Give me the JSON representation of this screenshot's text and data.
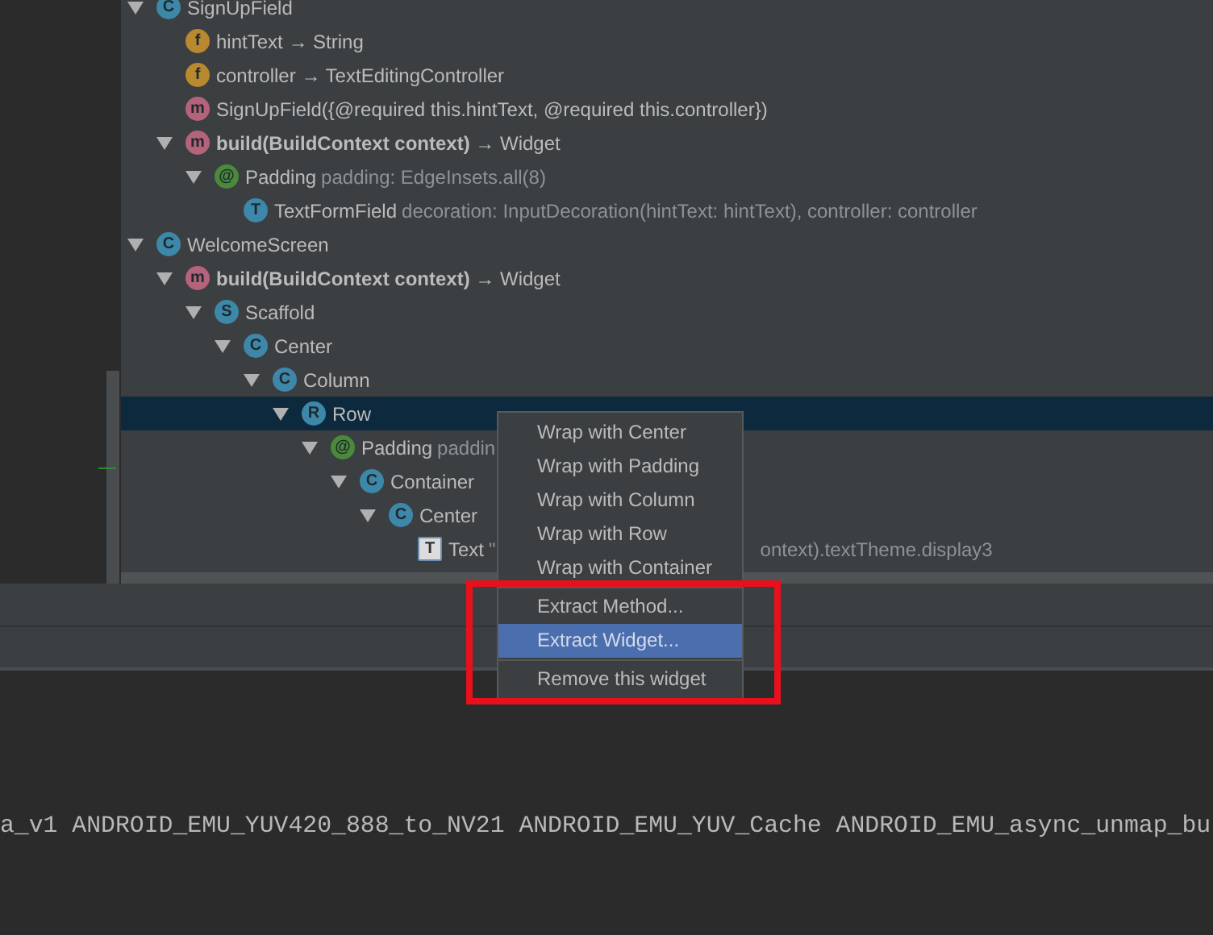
{
  "structure_tree": [
    {
      "letter": "C",
      "kind": "class",
      "name": "SignUpField",
      "expanded": true,
      "selected": false,
      "children": [
        {
          "letter": "f",
          "kind": "field",
          "name": "hintText → String",
          "selected": false
        },
        {
          "letter": "f",
          "kind": "field",
          "name": "controller → TextEditingController",
          "selected": false
        },
        {
          "letter": "m",
          "kind": "method",
          "name": "SignUpField({@required this.hintText, @required this.controller})",
          "selected": false
        },
        {
          "letter": "m",
          "kind": "method",
          "name": "**build(BuildContext context)** → Widget",
          "expanded": true,
          "selected": false,
          "children": [
            {
              "letter": "@",
              "kind": "annotation",
              "name": "Padding",
              "detail": "padding: EdgeInsets.all(8)",
              "expanded": true,
              "selected": false,
              "children": [
                {
                  "letter": "T",
                  "kind": "class",
                  "name": "TextFormField",
                  "detail": "decoration: InputDecoration(hintText: hintText), controller: controller",
                  "selected": false
                }
              ]
            }
          ]
        }
      ]
    },
    {
      "letter": "C",
      "kind": "class",
      "name": "WelcomeScreen",
      "expanded": true,
      "selected": false,
      "children": [
        {
          "letter": "m",
          "kind": "method",
          "name": "**build(BuildContext context)** → Widget",
          "expanded": true,
          "selected": false,
          "children": [
            {
              "letter": "S",
              "kind": "class",
              "name": "Scaffold",
              "expanded": true,
              "selected": false,
              "children": [
                {
                  "letter": "C",
                  "kind": "class",
                  "name": "Center",
                  "expanded": true,
                  "selected": false,
                  "children": [
                    {
                      "letter": "C",
                      "kind": "class",
                      "name": "Column",
                      "expanded": true,
                      "selected": false,
                      "children": [
                        {
                          "letter": "R",
                          "kind": "class",
                          "name": "Row",
                          "expanded": true,
                          "selected": true,
                          "children": [
                            {
                              "letter": "@",
                              "kind": "annotation",
                              "name": "Padding",
                              "detail": "paddin",
                              "expanded": true,
                              "selected": false,
                              "children": [
                                {
                                  "letter": "C",
                                  "kind": "class",
                                  "name": "Container",
                                  "expanded": true,
                                  "selected": false,
                                  "children": [
                                    {
                                      "letter": "C",
                                      "kind": "class",
                                      "name": "Center",
                                      "expanded": true,
                                      "selected": false,
                                      "children": [
                                        {
                                          "letter": "T",
                                          "kind": "text",
                                          "name": "Text",
                                          "detail": "\"",
                                          "detail_after_menu": "ontext).textTheme.display3",
                                          "selected": false
                                        }
                                      ]
                                    }
                                  ]
                                }
                              ]
                            }
                          ]
                        }
                      ]
                    }
                  ]
                }
              ]
            }
          ]
        }
      ]
    }
  ],
  "context_menu": [
    {
      "label": "Wrap with Center",
      "selected": false
    },
    {
      "label": "Wrap with Padding",
      "selected": false
    },
    {
      "label": "Wrap with Column",
      "selected": false
    },
    {
      "label": "Wrap with Row",
      "selected": false
    },
    {
      "label": "Wrap with Container",
      "selected": false
    },
    {
      "kind": "separator"
    },
    {
      "label": "Extract Method...",
      "selected": false
    },
    {
      "label": "Extract Widget...",
      "selected": true
    },
    {
      "kind": "separator"
    },
    {
      "label": "Remove this widget",
      "selected": false
    }
  ],
  "console": {
    "line": "a_v1 ANDROID_EMU_YUV420_888_to_NV21 ANDROID_EMU_YUV_Cache ANDROID_EMU_async_unmap_bu"
  }
}
